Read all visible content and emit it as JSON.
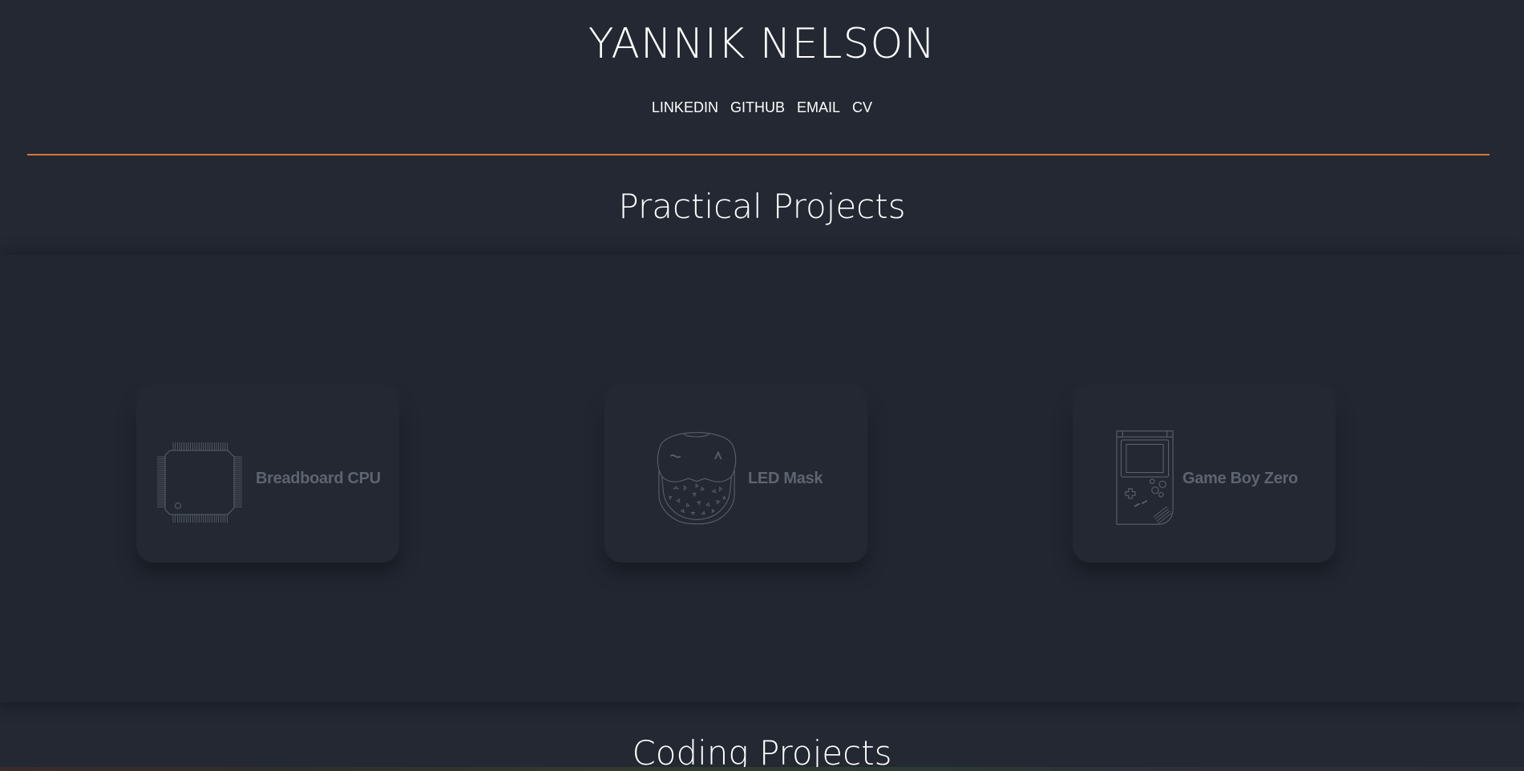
{
  "header": {
    "title": "YANNIK NELSON",
    "nav": [
      {
        "label": "LINKEDIN"
      },
      {
        "label": "GITHUB"
      },
      {
        "label": "EMAIL"
      },
      {
        "label": "CV"
      }
    ]
  },
  "colors": {
    "background": "#232833",
    "accent": "#d8773a",
    "card_label": "#5e6470",
    "icon_stroke": "#5a606b"
  },
  "practical": {
    "heading": "Practical Projects",
    "cards": [
      {
        "label": "Breadboard CPU",
        "icon": "cpu-chip-icon"
      },
      {
        "label": "LED Mask",
        "icon": "led-mask-icon"
      },
      {
        "label": "Game Boy Zero",
        "icon": "game-boy-icon"
      }
    ]
  },
  "coding": {
    "heading": "Coding Projects"
  }
}
